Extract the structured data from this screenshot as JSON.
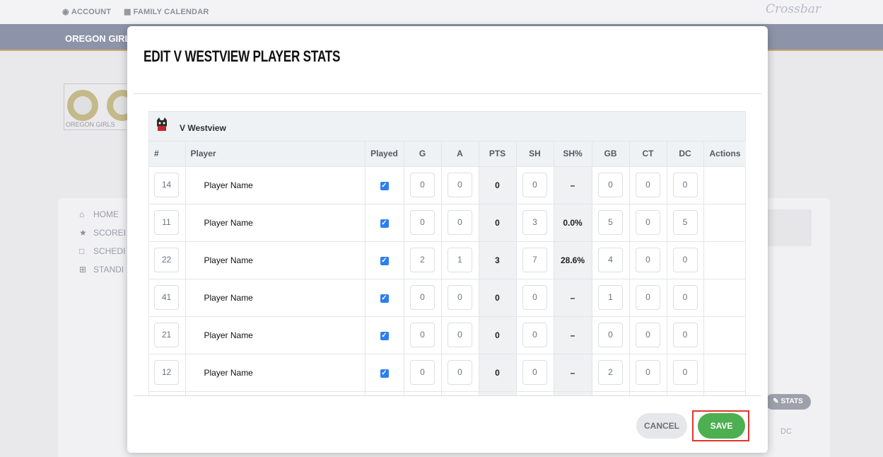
{
  "nav": {
    "account_label": "ACCOUNT",
    "calendar_label": "FAMILY CALENDAR",
    "brand": "Crossbar"
  },
  "team": {
    "name": "OREGON GIRL",
    "logo_caption": "OREGON GIRLS"
  },
  "side_nav": [
    {
      "label": "HOME",
      "icon": "home-icon"
    },
    {
      "label": "SCOREI",
      "icon": "star-icon"
    },
    {
      "label": "SCHEDI",
      "icon": "calendar-icon"
    },
    {
      "label": "STANDI",
      "icon": "grid-icon"
    }
  ],
  "background": {
    "stats_label": "STATS",
    "dc_label": "DC"
  },
  "modal": {
    "title": "Edit V Westview Player Stats",
    "team_name": "V Westview",
    "columns": [
      "#",
      "Player",
      "Played",
      "G",
      "A",
      "PTS",
      "SH",
      "SH%",
      "GB",
      "CT",
      "DC",
      "Actions"
    ],
    "rows": [
      {
        "number": "14",
        "player": "Player Name",
        "played": true,
        "g": "0",
        "a": "0",
        "pts": "0",
        "sh": "0",
        "sh_pct": "–",
        "gb": "0",
        "ct": "0",
        "dc": "0"
      },
      {
        "number": "11",
        "player": "Player Name",
        "played": true,
        "g": "0",
        "a": "0",
        "pts": "0",
        "sh": "3",
        "sh_pct": "0.0%",
        "gb": "5",
        "ct": "0",
        "dc": "5"
      },
      {
        "number": "22",
        "player": "Player Name",
        "played": true,
        "g": "2",
        "a": "1",
        "pts": "3",
        "sh": "7",
        "sh_pct": "28.6%",
        "gb": "4",
        "ct": "0",
        "dc": "0"
      },
      {
        "number": "41",
        "player": "Player Name",
        "played": true,
        "g": "0",
        "a": "0",
        "pts": "0",
        "sh": "0",
        "sh_pct": "–",
        "gb": "1",
        "ct": "0",
        "dc": "0"
      },
      {
        "number": "21",
        "player": "Player Name",
        "played": true,
        "g": "0",
        "a": "0",
        "pts": "0",
        "sh": "0",
        "sh_pct": "–",
        "gb": "0",
        "ct": "0",
        "dc": "0"
      },
      {
        "number": "12",
        "player": "Player Name",
        "played": true,
        "g": "0",
        "a": "0",
        "pts": "0",
        "sh": "0",
        "sh_pct": "–",
        "gb": "2",
        "ct": "0",
        "dc": "0"
      }
    ],
    "cancel_label": "CANCEL",
    "save_label": "SAVE"
  },
  "colors": {
    "team_bar": "#8d93a8",
    "save_green": "#4caf50",
    "checkbox_blue": "#2d7ff0",
    "highlight_red": "#e0362c"
  }
}
